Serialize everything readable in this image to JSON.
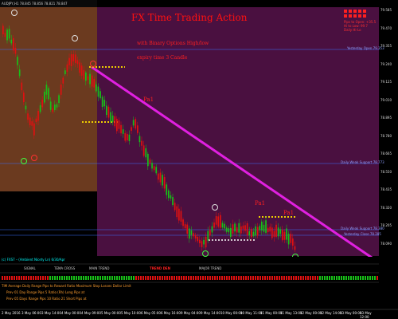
{
  "window": {
    "title": "AUDJPY,H1  78.845 78.856 78.821 78.847"
  },
  "overlay": {
    "title": "FX Time Trading Action",
    "subtitle": "with Binary Options High/low",
    "expiry": "expiry time 3 Candle",
    "label_1": "Pa1",
    "label_2": "Pa1",
    "label_3": "Pa1"
  },
  "info_panel": {
    "line1": "Pips to Open: +35.5",
    "line2": "Hi to Low: 99.7",
    "line3": "Daily Hi-Lo"
  },
  "levels": {
    "l1": "Yesterday Open 79.353",
    "l2": "Daily Weak Support 78.773",
    "l3": "Daily Weak Support 78.380",
    "l4": "Yesterday Close 78.285"
  },
  "price_scale": [
    "79.585",
    "79.470",
    "79.355",
    "79.240",
    "79.125",
    "79.010",
    "78.895",
    "78.780",
    "78.665",
    "78.550",
    "78.435",
    "78.320",
    "78.205",
    "78.090"
  ],
  "bottom": {
    "footer": "(c) FXS7 – (Ambient Nicety Ln) 6/30/Apr",
    "row1_a": "SIGNAL",
    "row1_b": "TEMA CROSS",
    "row1_c": "MAIN TREND",
    "row1_d": "TREND DEN",
    "row1_e": "MAJOR TREND",
    "row2": "TIM  Average Daily Range   Pips to Reward Ratio   Maximum Stop Losses   Dollar Limit",
    "row3": "Prev 01 Day Range   Pips 5   Ratio (Rh)   Long   Pips at",
    "row4": "Prev 05 Days Range   Pips 10   Ratio 21   Short   Pips at"
  },
  "time_axis": [
    "2 May 2016",
    "3 May 06:00",
    "3 May 14:00",
    "4 May 00:00",
    "4 May 09:00",
    "5 May 00:00",
    "5 May 10:00",
    "6 May 05:00",
    "6 May 16:00",
    "9 May 04:00",
    "9 May 14:00",
    "10 May 00:00",
    "10 May 11:00",
    "11 May 00:00",
    "11 May 13:00",
    "12 May 00:00",
    "12 May 14:00",
    "13 May 00:00",
    "13 May 12:00"
  ],
  "colors": {
    "box": "#6b3a1f",
    "zone": "#4a1040",
    "trend": "#e020e0",
    "bear": "#e01010",
    "bull": "#18c018",
    "title": "#ff0000"
  }
}
